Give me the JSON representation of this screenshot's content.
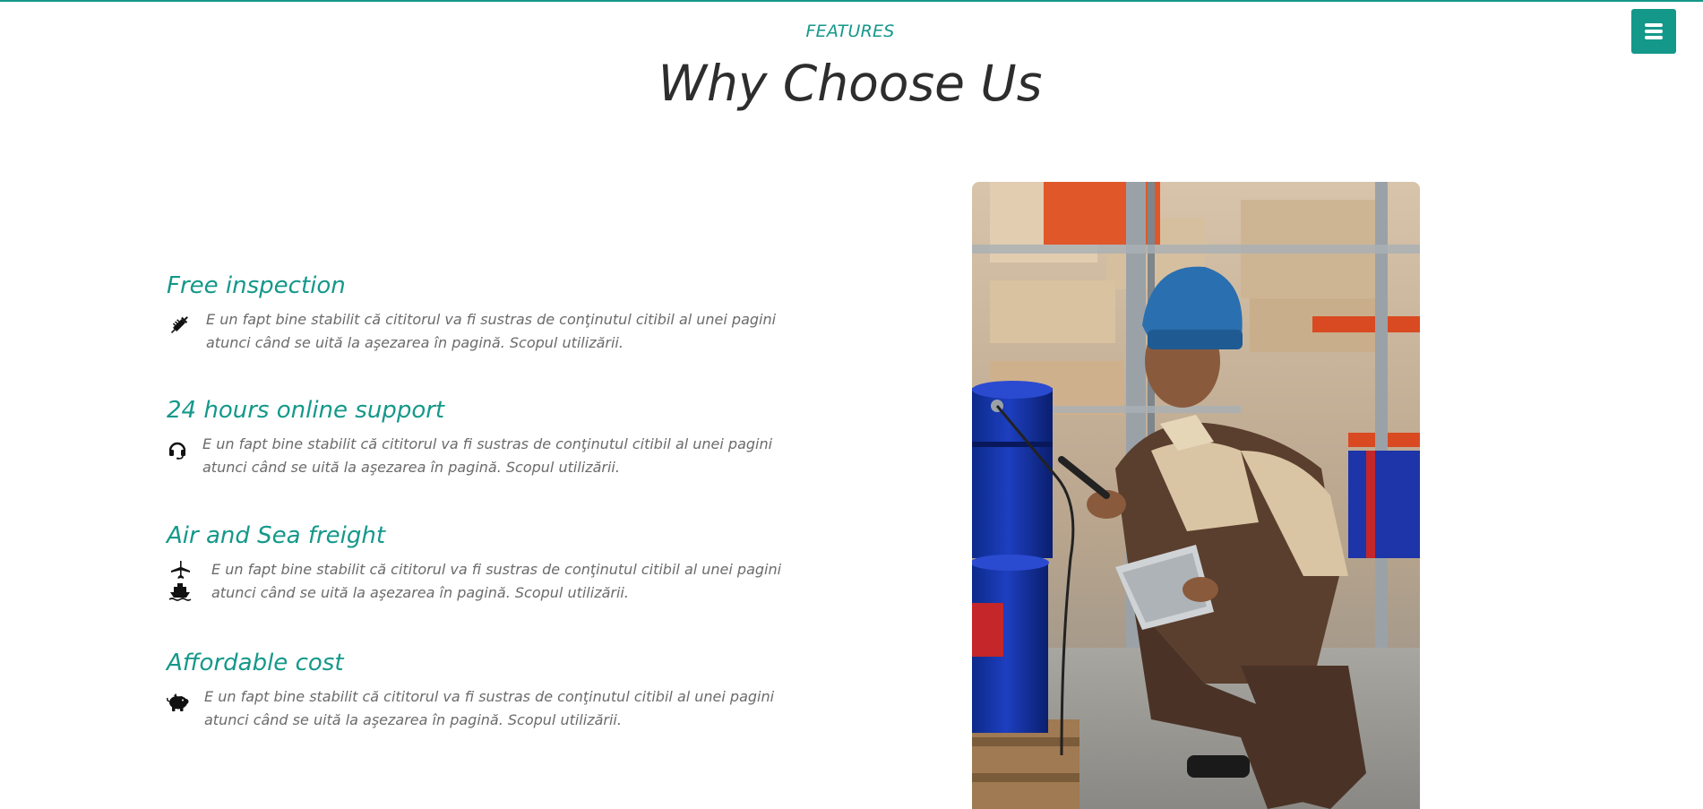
{
  "header": {
    "menu_icon": "hamburger-icon",
    "accent_color": "#14988a"
  },
  "section": {
    "eyebrow": "FEATURES",
    "title": "Why Choose Us"
  },
  "features": [
    {
      "title": "Free inspection",
      "icon": "syringe-icon",
      "text": "E un fapt bine stabilit că cititorul va fi sustras de conţinutul citibil al unei pagini atunci când se uită la aşezarea în pagină. Scopul utilizării."
    },
    {
      "title": "24 hours online support",
      "icon": "headset-icon",
      "text": "E un fapt bine stabilit că cititorul va fi sustras de conţinutul citibil al unei pagini atunci când se uită la aşezarea în pagină. Scopul utilizării."
    },
    {
      "title": "Air and Sea freight",
      "icon": "plane-ship-icon",
      "text": "E un fapt bine stabilit că cititorul va fi sustras de conţinutul citibil al unei pagini atunci când se uită la aşezarea în pagină. Scopul utilizării."
    },
    {
      "title": "Affordable cost",
      "icon": "piggy-bank-icon",
      "text": "E un fapt bine stabilit că cititorul va fi sustras de conţinutul citibil al unei pagini atunci când se uită la aşezarea în pagină. Scopul utilizării."
    }
  ],
  "image": {
    "subject": "warehouse-worker-photo"
  }
}
